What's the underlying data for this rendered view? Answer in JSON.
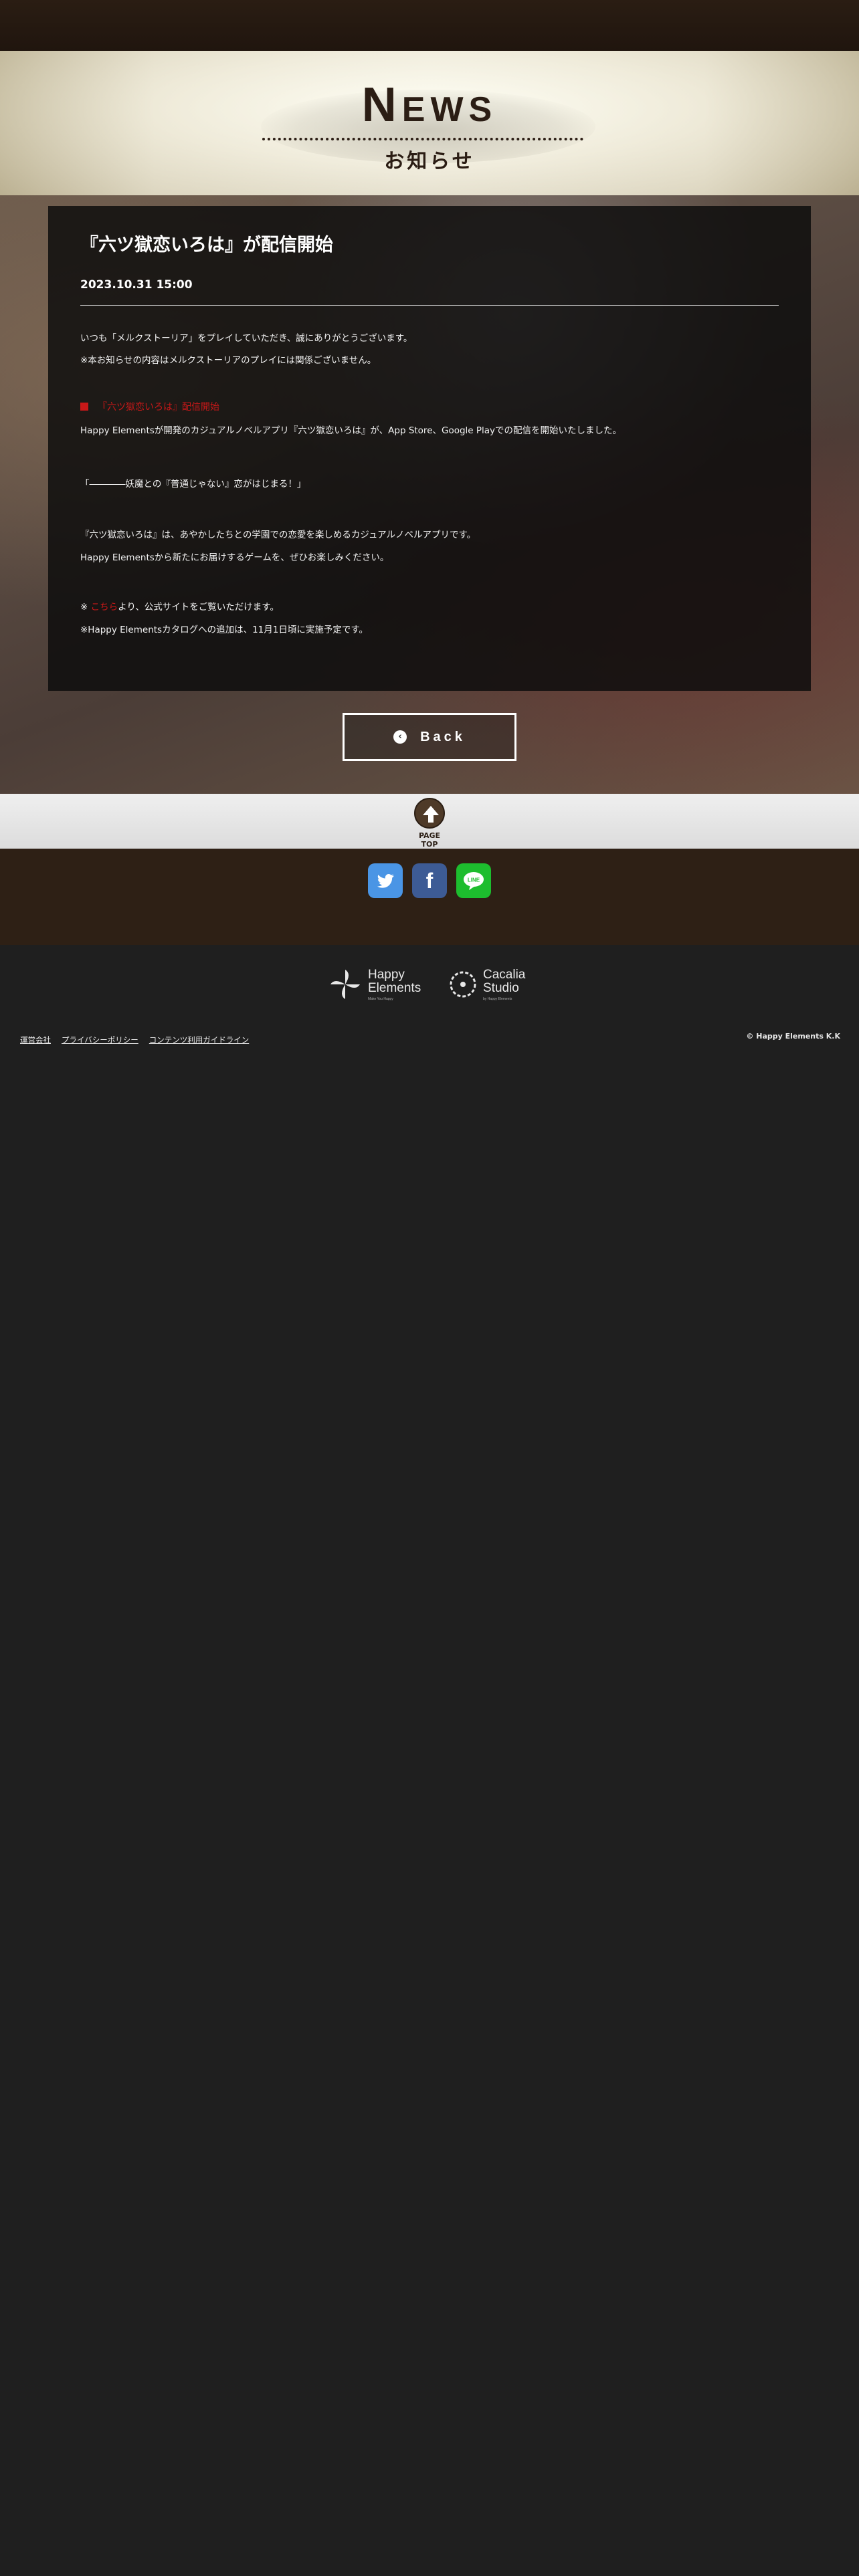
{
  "header": {
    "news_initial": "N",
    "news_rest": "EWS",
    "subtitle": "お知らせ"
  },
  "article": {
    "title": "『六ツ獄恋いろは』が配信開始",
    "date": "2023.10.31  15:00",
    "intro": [
      "いつも「メルクストーリア」をプレイしていただき、誠にありがとうございます。",
      "※本お知らせの内容はメルクストーリアのプレイには関係ございません。"
    ],
    "section_heading": "『六ツ獄恋いろは』配信開始",
    "announcement": "Happy Elementsが開発のカジュアルノベルアプリ『六ツ獄恋いろは』が、App Store、Google Playでの配信を開始いたしました。",
    "tagline": "「――――妖魔との『普通じゃない』恋がはじまる！」",
    "description": [
      "『六ツ獄恋いろは』は、あやかしたちとの学園での恋愛を楽しめるカジュアルノベルアプリです。",
      "Happy Elementsから新たにお届けするゲームを、ぜひお楽しみください。"
    ],
    "note_prefix": "※",
    "note_link": "こちら",
    "note_suffix": "より、公式サイトをご覧いただけます。",
    "note2": "※Happy Elementsカタログへの追加は、11月1日頃に実施予定です。"
  },
  "back_button": {
    "label": "Back",
    "icon": "chevron-left-circle-icon"
  },
  "page_top": {
    "label": "PAGE TOP",
    "icon": "arrow-up-icon"
  },
  "social": {
    "twitter_icon": "twitter-bird-icon",
    "facebook_icon": "facebook-f-icon",
    "line_icon": "line-bubble-icon",
    "twitter_color": "#4a95e5",
    "facebook_color": "#3d5b95",
    "line_color": "#1dbd2e"
  },
  "logos": {
    "happy_elements": {
      "line1": "Happy",
      "line2": "Elements",
      "tagline": "Make You Happy"
    },
    "cacalia": {
      "line1": "Cacalia",
      "line2": "Studio",
      "tagline": "by Happy Elements"
    }
  },
  "footer": {
    "links": [
      "運営会社",
      "プライバシーポリシー",
      "コンテンツ利用ガイドライン"
    ],
    "copyright": "© Happy Elements K.K"
  },
  "colors": {
    "accent_red": "#c81818",
    "header_brown": "#2b1d14",
    "footer_bg": "#1f1f1f"
  }
}
